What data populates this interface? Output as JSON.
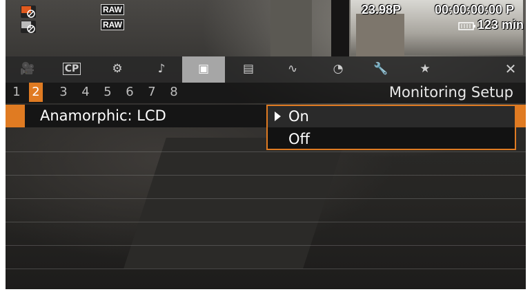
{
  "status": {
    "raw_top": "RAW",
    "raw_bottom": "RAW",
    "frame_rate": "23.98P",
    "timecode": "00:00:00:00 P",
    "battery_time": "123 min"
  },
  "tabs": [
    {
      "name": "camera-tab",
      "glyph": "🎥"
    },
    {
      "name": "custom-picture-tab",
      "glyph": "CP"
    },
    {
      "name": "camera-setup-tab",
      "glyph": "⚙"
    },
    {
      "name": "audio-tab",
      "glyph": "♪"
    },
    {
      "name": "monitoring-tab",
      "glyph": "▣"
    },
    {
      "name": "recording-tab",
      "glyph": "▤"
    },
    {
      "name": "assistance-tab",
      "glyph": "∿"
    },
    {
      "name": "system-tab",
      "glyph": "◔"
    },
    {
      "name": "settings-tab",
      "glyph": "🔧"
    },
    {
      "name": "my-menu-tab",
      "glyph": "★"
    },
    {
      "name": "close-tab",
      "glyph": "✕"
    }
  ],
  "pages": [
    "1",
    "2",
    "3",
    "4",
    "5",
    "6",
    "7",
    "8"
  ],
  "active_page": "2",
  "menu_title": "Monitoring Setup",
  "setting": {
    "label": "Anamorphic: LCD",
    "options": [
      "On",
      "Off"
    ],
    "selected": "On"
  },
  "colors": {
    "accent": "#e07b22",
    "tab_active": "#a6a6a6"
  }
}
